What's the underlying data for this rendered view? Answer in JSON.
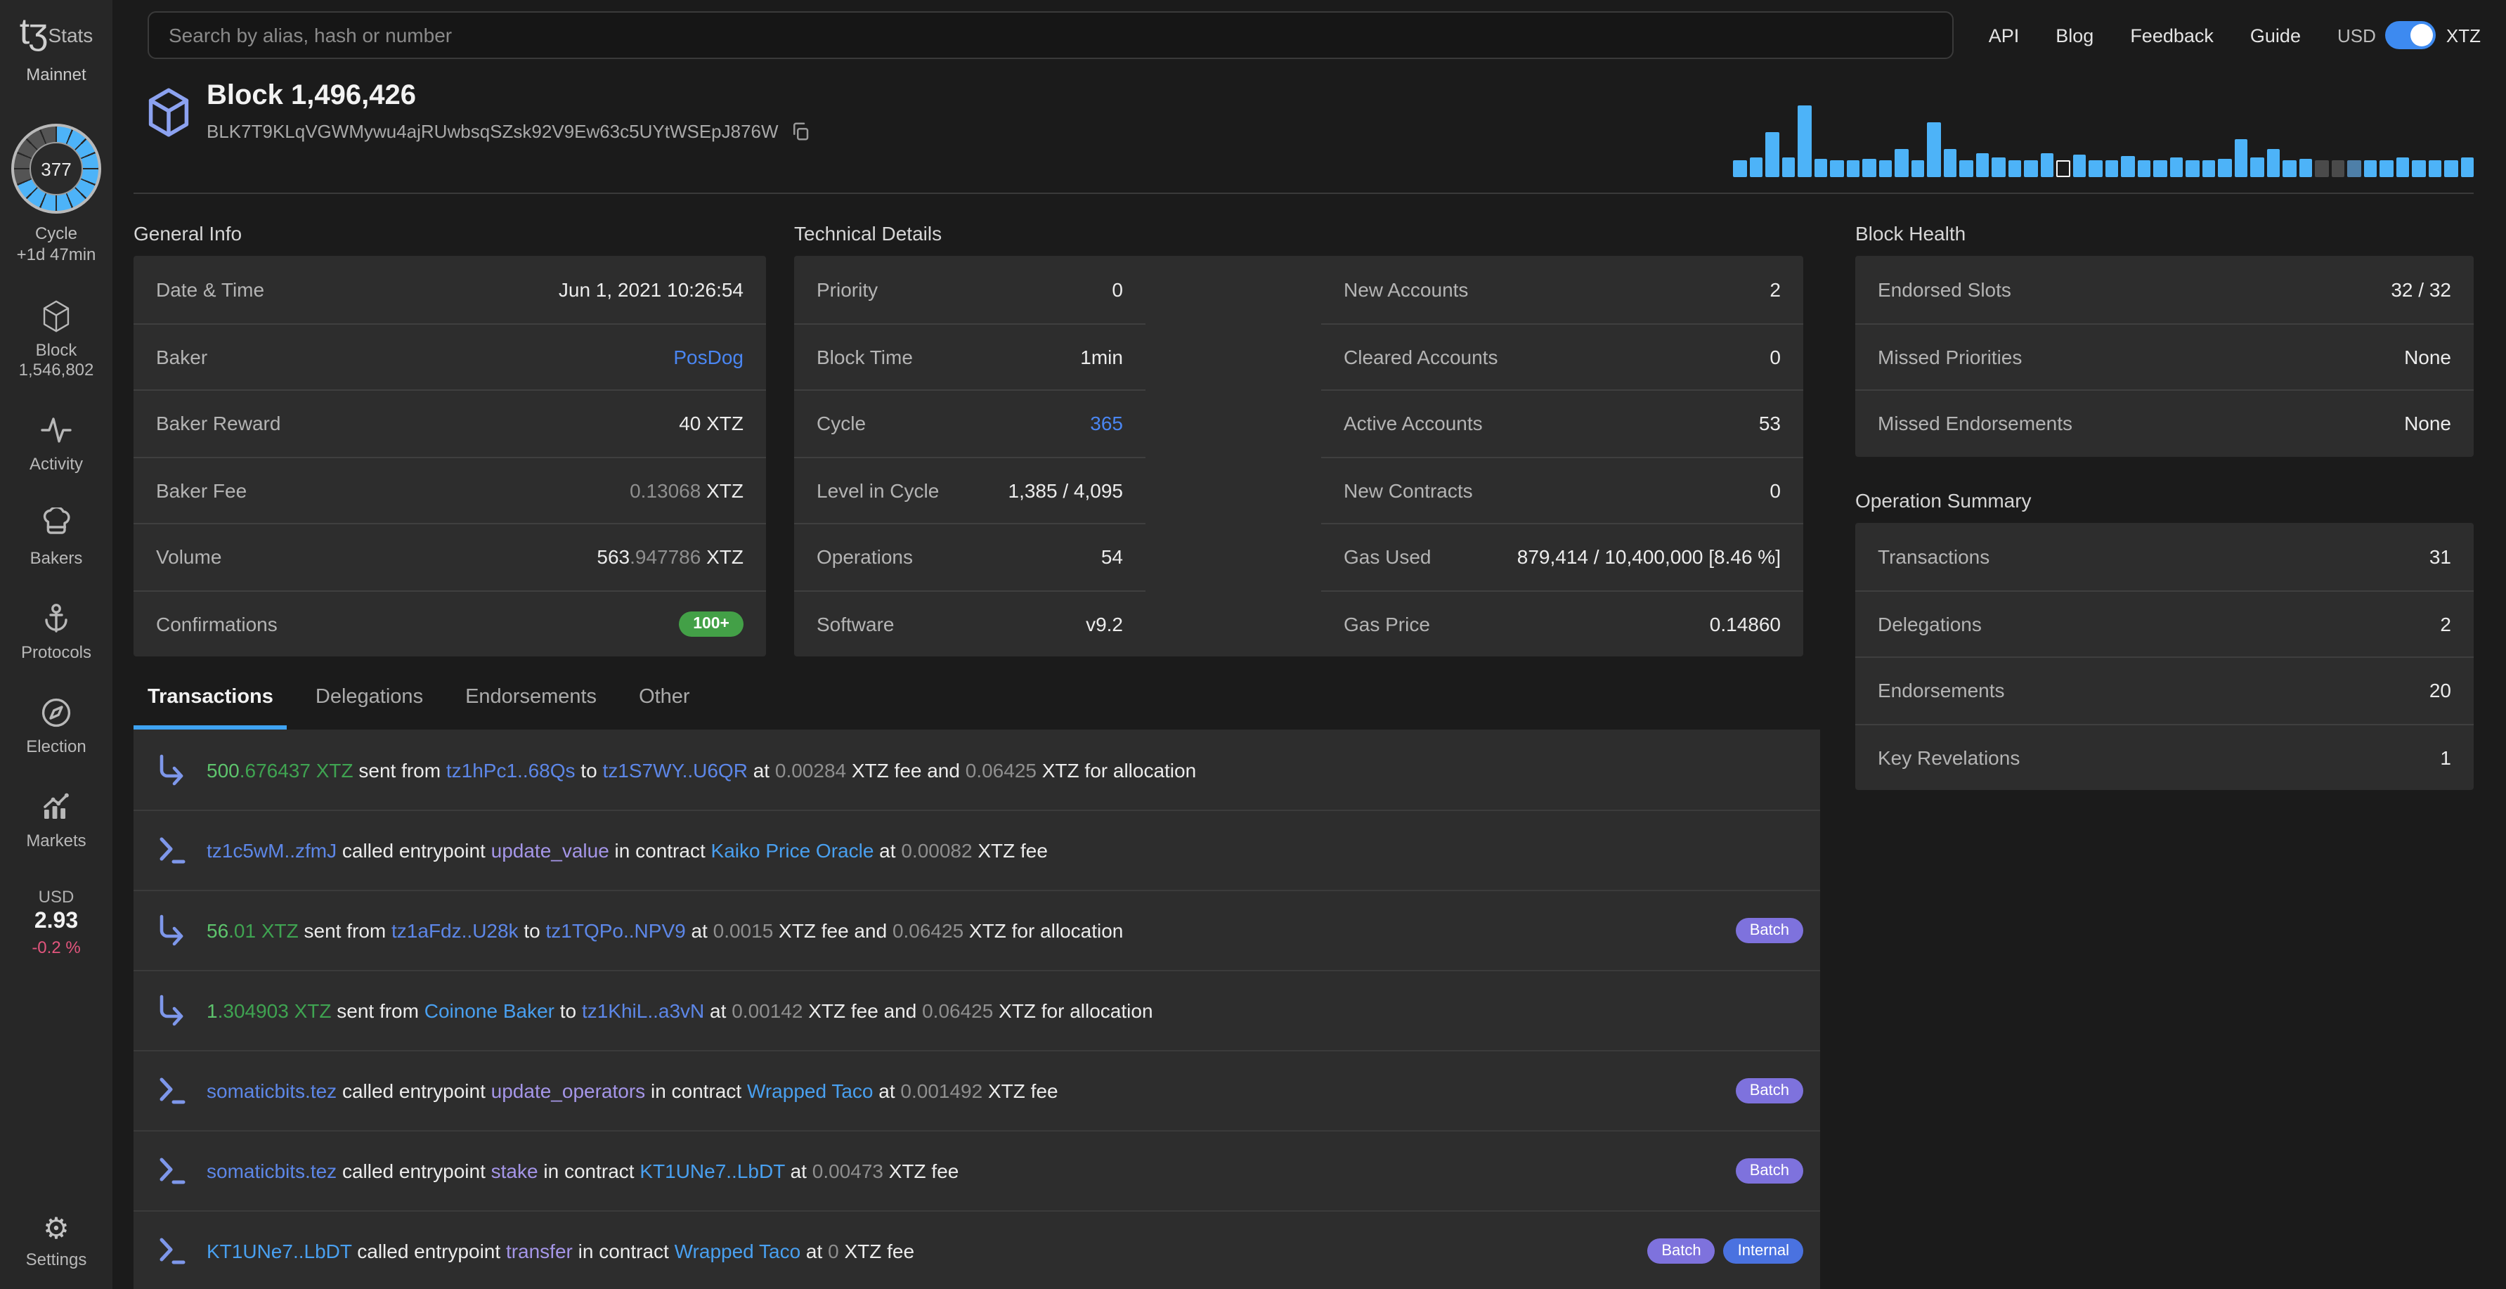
{
  "topbar": {
    "search_placeholder": "Search by alias, hash or number",
    "links": [
      "API",
      "Blog",
      "Feedback",
      "Guide"
    ],
    "currency": {
      "left": "USD",
      "right": "XTZ",
      "active": "XTZ"
    }
  },
  "sidebar": {
    "logo": "tʒ",
    "logo_suffix": "Stats",
    "network": "Mainnet",
    "cycle": {
      "number": "377",
      "label": "Cycle",
      "eta": "+1d 47min",
      "segments": 16,
      "filled": 11
    },
    "items": [
      {
        "icon": "cube",
        "label": "Block",
        "sublabel": "1,546,802"
      },
      {
        "icon": "activity",
        "label": "Activity"
      },
      {
        "icon": "chef-hat",
        "label": "Bakers"
      },
      {
        "icon": "anchor",
        "label": "Protocols"
      },
      {
        "icon": "compass",
        "label": "Election"
      },
      {
        "icon": "market",
        "label": "Markets"
      }
    ],
    "price": {
      "currency": "USD",
      "value": "2.93",
      "change": "-0.2 %"
    },
    "settings_label": "Settings"
  },
  "header": {
    "title": "Block 1,496,426",
    "hash": "BLK7T9KLqVGWMywu4ajRUwbsqSZsk92V9Ew63c5UYtWSEpJ876W"
  },
  "chart_data": {
    "type": "bar",
    "title": "",
    "description": "block operations histogram strip, selected block outlined",
    "values": [
      12,
      14,
      32,
      14,
      51,
      13,
      12,
      12,
      13,
      12,
      20,
      12,
      39,
      20,
      12,
      17,
      14,
      12,
      12,
      17,
      12,
      16,
      12,
      12,
      15,
      12,
      12,
      14,
      12,
      12,
      13,
      27,
      14,
      20,
      12,
      13,
      12,
      12,
      12,
      12,
      12,
      14,
      12,
      12,
      12,
      14
    ],
    "states": {
      "20": "selected",
      "36": "gray",
      "37": "gray",
      "38": "muted"
    },
    "colors": {
      "bar": "#4db3f8",
      "gray": "#4a4a4a",
      "muted": "#4e7fa8",
      "selected_outline": "#ffffff"
    }
  },
  "sections": {
    "general_info": {
      "title": "General Info",
      "rows": [
        {
          "label": "Date & Time",
          "parts": [
            [
              "Jun 1, 2021 10:26:54",
              "p"
            ]
          ]
        },
        {
          "label": "Baker",
          "parts": [
            [
              "PosDog",
              "link"
            ]
          ]
        },
        {
          "label": "Baker Reward",
          "parts": [
            [
              "40 XTZ",
              "p"
            ]
          ]
        },
        {
          "label": "Baker Fee",
          "parts": [
            [
              "0.13068",
              "d"
            ],
            [
              " XTZ",
              "p"
            ]
          ]
        },
        {
          "label": "Volume",
          "parts": [
            [
              "563",
              "p"
            ],
            [
              ".947786",
              "d"
            ],
            [
              " XTZ",
              "p"
            ]
          ]
        },
        {
          "label": "Confirmations",
          "badge": {
            "text": "100+",
            "cls": "bg-green"
          }
        }
      ]
    },
    "technical_details": {
      "title": "Technical Details",
      "left_rows": [
        {
          "label": "Priority",
          "parts": [
            [
              "0",
              "p"
            ]
          ]
        },
        {
          "label": "Block Time",
          "parts": [
            [
              "1min",
              "p"
            ]
          ]
        },
        {
          "label": "Cycle",
          "parts": [
            [
              "365",
              "link"
            ]
          ]
        },
        {
          "label": "Level in Cycle",
          "parts": [
            [
              "1,385 / 4,095",
              "p"
            ]
          ]
        },
        {
          "label": "Operations",
          "parts": [
            [
              "54",
              "p"
            ]
          ]
        },
        {
          "label": "Software",
          "parts": [
            [
              "v9.2",
              "p"
            ]
          ]
        }
      ],
      "right_rows": [
        {
          "label": "New Accounts",
          "parts": [
            [
              "2",
              "p"
            ]
          ]
        },
        {
          "label": "Cleared Accounts",
          "parts": [
            [
              "0",
              "p"
            ]
          ]
        },
        {
          "label": "Active Accounts",
          "parts": [
            [
              "53",
              "p"
            ]
          ]
        },
        {
          "label": "New Contracts",
          "parts": [
            [
              "0",
              "p"
            ]
          ]
        },
        {
          "label": "Gas Used",
          "parts": [
            [
              "879,414 / 10,400,000  [8.46 %]",
              "p"
            ]
          ]
        },
        {
          "label": "Gas Price",
          "parts": [
            [
              "0.14860",
              "p"
            ]
          ]
        }
      ]
    },
    "block_health": {
      "title": "Block Health",
      "rows": [
        {
          "label": "Endorsed Slots",
          "parts": [
            [
              "32 / 32",
              "p"
            ]
          ]
        },
        {
          "label": "Missed Priorities",
          "parts": [
            [
              "None",
              "p"
            ]
          ]
        },
        {
          "label": "Missed Endorsements",
          "parts": [
            [
              "None",
              "p"
            ]
          ]
        }
      ]
    },
    "operation_summary": {
      "title": "Operation Summary",
      "rows": [
        {
          "label": "Transactions",
          "parts": [
            [
              "31",
              "p"
            ]
          ]
        },
        {
          "label": "Delegations",
          "parts": [
            [
              "2",
              "p"
            ]
          ]
        },
        {
          "label": "Endorsements",
          "parts": [
            [
              "20",
              "p"
            ]
          ]
        },
        {
          "label": "Key Revelations",
          "parts": [
            [
              "1",
              "p"
            ]
          ]
        }
      ]
    },
    "operations": {
      "tabs": [
        {
          "label": "Transactions",
          "active": true
        },
        {
          "label": "Delegations",
          "active": false
        },
        {
          "label": "Endorsements",
          "active": false
        },
        {
          "label": "Other",
          "active": false
        }
      ],
      "rows": [
        {
          "icon": "send",
          "badges": [],
          "segments": [
            [
              "500",
              "gi"
            ],
            [
              ".676437 XTZ",
              "gd"
            ],
            [
              " sent from ",
              "p"
            ],
            [
              "tz1hPc1..68Qs",
              "a"
            ],
            [
              " to ",
              "p"
            ],
            [
              "tz1S7WY..U6QR",
              "a"
            ],
            [
              " at ",
              "p"
            ],
            [
              "0.00284",
              "d"
            ],
            [
              " XTZ fee and ",
              "p"
            ],
            [
              "0.06425",
              "d"
            ],
            [
              " XTZ for allocation",
              "p"
            ]
          ]
        },
        {
          "icon": "call",
          "badges": [],
          "segments": [
            [
              "tz1c5wM..zfmJ",
              "a"
            ],
            [
              " called entrypoint ",
              "p"
            ],
            [
              "update_value",
              "e"
            ],
            [
              " in contract ",
              "p"
            ],
            [
              "Kaiko Price Oracle",
              "al"
            ],
            [
              " at ",
              "p"
            ],
            [
              "0.00082",
              "d"
            ],
            [
              " XTZ fee",
              "p"
            ]
          ]
        },
        {
          "icon": "send",
          "badges": [
            {
              "text": "Batch",
              "cls": "bg-purple"
            }
          ],
          "segments": [
            [
              "56",
              "gi"
            ],
            [
              ".01 XTZ",
              "gd"
            ],
            [
              " sent from ",
              "p"
            ],
            [
              "tz1aFdz..U28k",
              "a"
            ],
            [
              " to ",
              "p"
            ],
            [
              "tz1TQPo..NPV9",
              "a"
            ],
            [
              " at ",
              "p"
            ],
            [
              "0.0015",
              "d"
            ],
            [
              " XTZ fee and ",
              "p"
            ],
            [
              "0.06425",
              "d"
            ],
            [
              " XTZ for allocation",
              "p"
            ]
          ]
        },
        {
          "icon": "send",
          "badges": [],
          "segments": [
            [
              "1",
              "gi"
            ],
            [
              ".304903 XTZ",
              "gd"
            ],
            [
              " sent from ",
              "p"
            ],
            [
              "Coinone Baker",
              "al"
            ],
            [
              " to ",
              "p"
            ],
            [
              "tz1KhiL..a3vN",
              "a"
            ],
            [
              " at ",
              "p"
            ],
            [
              "0.00142",
              "d"
            ],
            [
              " XTZ fee and ",
              "p"
            ],
            [
              "0.06425",
              "d"
            ],
            [
              " XTZ for allocation",
              "p"
            ]
          ]
        },
        {
          "icon": "call",
          "badges": [
            {
              "text": "Batch",
              "cls": "bg-purple"
            }
          ],
          "segments": [
            [
              "somaticbits.tez",
              "a"
            ],
            [
              " called entrypoint ",
              "p"
            ],
            [
              "update_operators",
              "e"
            ],
            [
              " in contract ",
              "p"
            ],
            [
              "Wrapped Taco",
              "al"
            ],
            [
              " at ",
              "p"
            ],
            [
              "0.001492",
              "d"
            ],
            [
              " XTZ fee",
              "p"
            ]
          ]
        },
        {
          "icon": "call",
          "badges": [
            {
              "text": "Batch",
              "cls": "bg-purple"
            }
          ],
          "segments": [
            [
              "somaticbits.tez",
              "a"
            ],
            [
              " called entrypoint ",
              "p"
            ],
            [
              "stake",
              "e"
            ],
            [
              " in contract ",
              "p"
            ],
            [
              "KT1UNe7..LbDT",
              "al"
            ],
            [
              " at ",
              "p"
            ],
            [
              "0.00473",
              "d"
            ],
            [
              " XTZ fee",
              "p"
            ]
          ]
        },
        {
          "icon": "call",
          "badges": [
            {
              "text": "Batch",
              "cls": "bg-purple"
            },
            {
              "text": "Internal",
              "cls": "bg-blue"
            }
          ],
          "segments": [
            [
              "KT1UNe7..LbDT",
              "al"
            ],
            [
              " called entrypoint ",
              "p"
            ],
            [
              "transfer",
              "e"
            ],
            [
              " in contract ",
              "p"
            ],
            [
              "Wrapped Taco",
              "al"
            ],
            [
              " at ",
              "p"
            ],
            [
              "0",
              "d"
            ],
            [
              " XTZ fee",
              "p"
            ]
          ]
        }
      ]
    }
  }
}
